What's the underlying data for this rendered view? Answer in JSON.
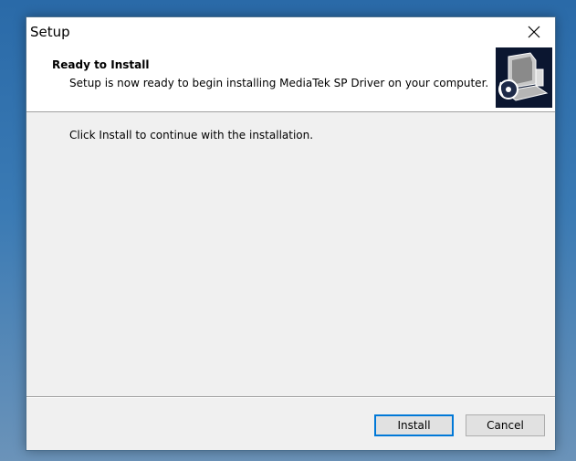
{
  "window": {
    "title": "Setup",
    "close_icon": "close-icon"
  },
  "header": {
    "title": "Ready to Install",
    "subtitle": "Setup is now ready to begin installing MediaTek SP Driver on your computer.",
    "image_icon": "setup-computer-icon"
  },
  "body": {
    "message": "Click Install to continue with the installation."
  },
  "buttons": {
    "install": "Install",
    "cancel": "Cancel"
  },
  "colors": {
    "accent": "#0078d7",
    "window_bg": "#f0f0f0",
    "header_bg": "#ffffff"
  }
}
